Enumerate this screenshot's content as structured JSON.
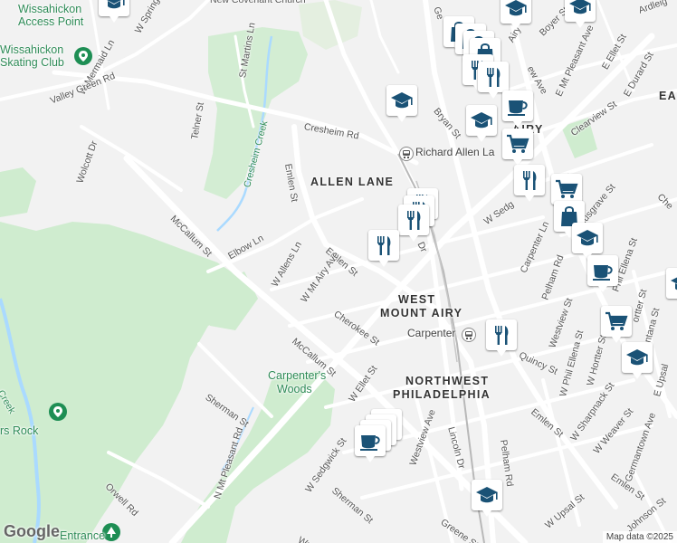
{
  "map": {
    "logo": "Google",
    "attribution": "Map data ©2025",
    "neighborhoods": [
      {
        "id": "allen-lane",
        "text": "ALLEN LANE"
      },
      {
        "id": "west-mount-airy-1",
        "text": "WEST"
      },
      {
        "id": "west-mount-airy-2",
        "text": "MOUNT AIRY"
      },
      {
        "id": "northwest-philadelphia-1",
        "text": "NORTHWEST"
      },
      {
        "id": "northwest-philadelphia-2",
        "text": "PHILADELPHIA"
      },
      {
        "id": "airy-partial",
        "text": "AIRY"
      },
      {
        "id": "east-partial",
        "text": "EAS"
      }
    ],
    "parks": [
      {
        "id": "wissahickon-access-1",
        "text": "Wissahickon"
      },
      {
        "id": "wissahickon-access-2",
        "text": "Access Point"
      },
      {
        "id": "skating-1",
        "text": "Wissahickon"
      },
      {
        "id": "skating-2",
        "text": "Skating Club"
      },
      {
        "id": "carpenters-woods-1",
        "text": "Carpenter's"
      },
      {
        "id": "carpenters-woods-2",
        "text": "Woods"
      },
      {
        "id": "rock",
        "text": "rs Rock"
      },
      {
        "id": "entrance",
        "text": "Entrance"
      },
      {
        "id": "cresheim-creek",
        "text": "Cresheim Creek"
      },
      {
        "id": "creek",
        "text": "Creek"
      }
    ],
    "transit": [
      {
        "id": "richard-allen",
        "text": "Richard Allen La"
      },
      {
        "id": "carpenter",
        "text": "Carpenter"
      }
    ],
    "places": [
      {
        "id": "church",
        "text": "New Covenant Church"
      }
    ],
    "streets": [
      {
        "id": "w-spring",
        "text": "W Spring"
      },
      {
        "id": "w-mermaid",
        "text": "W Mermaid Ln"
      },
      {
        "id": "st-martins",
        "text": "St Martins Ln"
      },
      {
        "id": "valley-green",
        "text": "Valley Green Rd"
      },
      {
        "id": "telner",
        "text": "Telner St"
      },
      {
        "id": "wolcott",
        "text": "Wolcott Dr"
      },
      {
        "id": "cresheim-rd",
        "text": "Cresheim Rd"
      },
      {
        "id": "emlen-1",
        "text": "Emlen St"
      },
      {
        "id": "mccallum-1",
        "text": "McCallum St"
      },
      {
        "id": "elbow",
        "text": "Elbow Ln"
      },
      {
        "id": "w-allens",
        "text": "W Allens Ln"
      },
      {
        "id": "emlen-2",
        "text": "Emlen St"
      },
      {
        "id": "w-mt-airy",
        "text": "W Mt Airy Ave"
      },
      {
        "id": "cherokee",
        "text": "Cherokee St"
      },
      {
        "id": "mccallum-2",
        "text": "McCallum St"
      },
      {
        "id": "sherman-1",
        "text": "Sherman St"
      },
      {
        "id": "n-mt-pleasant",
        "text": "N Mt Pleasant Rd"
      },
      {
        "id": "orwell",
        "text": "Orwell Rd"
      },
      {
        "id": "w-ellet",
        "text": "W Ellet St"
      },
      {
        "id": "w-sedgwick-1",
        "text": "W Sedgwick St"
      },
      {
        "id": "sherman-2",
        "text": "Sherman St"
      },
      {
        "id": "westview-1",
        "text": "Westview Ave"
      },
      {
        "id": "lincoln",
        "text": "Lincoln Dr"
      },
      {
        "id": "pelham-1",
        "text": "Pelham Rd"
      },
      {
        "id": "greene",
        "text": "Greene St"
      },
      {
        "id": "wayne",
        "text": "Wayn"
      },
      {
        "id": "bryan",
        "text": "Bryan St"
      },
      {
        "id": "ge",
        "text": "Ge"
      },
      {
        "id": "boyer",
        "text": "Boyer St"
      },
      {
        "id": "e-mt-pleasant",
        "text": "E Mt Pleasant Ave"
      },
      {
        "id": "e-ellet",
        "text": "E Ellet St"
      },
      {
        "id": "ardleigh",
        "text": "Ardleig"
      },
      {
        "id": "e-durard",
        "text": "E Durard St"
      },
      {
        "id": "clearview",
        "text": "Clearview St"
      },
      {
        "id": "mew-ave",
        "text": "ew Ave"
      },
      {
        "id": "airy-st",
        "text": "Airy"
      },
      {
        "id": "w-sedgwick-2",
        "text": "W Sedg"
      },
      {
        "id": "gas",
        "text": "gas Ln"
      },
      {
        "id": "musgrave",
        "text": "Musgrave St"
      },
      {
        "id": "carpenter-ln",
        "text": "Carpenter Ln"
      },
      {
        "id": "pelham-2",
        "text": "Pelham Rd"
      },
      {
        "id": "westview-2",
        "text": "Westview St"
      },
      {
        "id": "phil-ellena-1",
        "text": "Phil Ellena St"
      },
      {
        "id": "w-phil-ellena",
        "text": "W Phil Ellena St"
      },
      {
        "id": "hortter-1",
        "text": "ortter St"
      },
      {
        "id": "fontana",
        "text": "ontana St"
      },
      {
        "id": "w-hortter",
        "text": "W Hortter St"
      },
      {
        "id": "quincy",
        "text": "Quincy St"
      },
      {
        "id": "e-upsal",
        "text": "E Upsal"
      },
      {
        "id": "emlen-3",
        "text": "Emlen St"
      },
      {
        "id": "w-sharpnack",
        "text": "W Sharpnack St"
      },
      {
        "id": "w-weaver",
        "text": "W Weaver St"
      },
      {
        "id": "germantown",
        "text": "Germantown Ave"
      },
      {
        "id": "emlen-4",
        "text": "Emlen St"
      },
      {
        "id": "w-upsal",
        "text": "W Upsal St"
      },
      {
        "id": "johnson",
        "text": "Johnson St"
      },
      {
        "id": "che",
        "text": "Che"
      },
      {
        "id": "lincoln-dr-2",
        "text": "Dr"
      }
    ],
    "colors": {
      "land": "#f2f2f2",
      "park": "#cfeccf",
      "water": "#aadaff",
      "road": "#ffffff",
      "pin_icon": "#1a5276",
      "park_label": "#2e8b57"
    },
    "markers": [
      {
        "type": "school",
        "icon": "graduation-cap-icon"
      },
      {
        "type": "school",
        "icon": "graduation-cap-icon"
      },
      {
        "type": "school",
        "icon": "graduation-cap-icon"
      },
      {
        "type": "shopping",
        "icon": "shopping-bag-icon"
      },
      {
        "type": "shopping",
        "icon": "shopping-bag-icon"
      },
      {
        "type": "shopping",
        "icon": "shopping-bag-icon"
      },
      {
        "type": "shopping",
        "icon": "shopping-bag-icon"
      },
      {
        "type": "restaurant",
        "icon": "fork-knife-icon"
      },
      {
        "type": "restaurant",
        "icon": "fork-knife-icon"
      },
      {
        "type": "school",
        "icon": "graduation-cap-icon"
      },
      {
        "type": "cafe",
        "icon": "coffee-cup-icon"
      },
      {
        "type": "school",
        "icon": "graduation-cap-icon"
      },
      {
        "type": "grocery",
        "icon": "shopping-cart-icon"
      },
      {
        "type": "restaurant",
        "icon": "fork-knife-icon"
      },
      {
        "type": "grocery",
        "icon": "shopping-cart-icon"
      },
      {
        "type": "shopping",
        "icon": "shopping-bag-icon"
      },
      {
        "type": "restaurant",
        "icon": "fork-knife-icon"
      },
      {
        "type": "restaurant",
        "icon": "fork-knife-icon"
      },
      {
        "type": "restaurant",
        "icon": "fork-knife-icon"
      },
      {
        "type": "restaurant",
        "icon": "fork-knife-icon"
      },
      {
        "type": "school",
        "icon": "graduation-cap-icon"
      },
      {
        "type": "cafe",
        "icon": "coffee-cup-icon"
      },
      {
        "type": "restaurant",
        "icon": "fork-knife-icon"
      },
      {
        "type": "grocery",
        "icon": "shopping-cart-icon"
      },
      {
        "type": "school",
        "icon": "graduation-cap-icon"
      },
      {
        "type": "cafe",
        "icon": "coffee-cup-icon"
      },
      {
        "type": "cafe",
        "icon": "coffee-cup-icon"
      },
      {
        "type": "cafe",
        "icon": "coffee-cup-icon"
      },
      {
        "type": "cafe",
        "icon": "coffee-cup-icon"
      },
      {
        "type": "school",
        "icon": "graduation-cap-icon"
      },
      {
        "type": "school",
        "icon": "graduation-cap-icon"
      }
    ]
  }
}
